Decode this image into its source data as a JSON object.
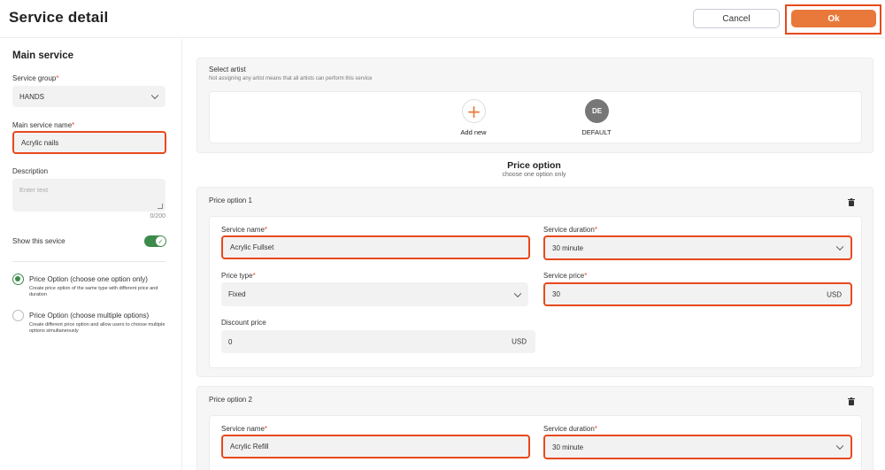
{
  "header": {
    "title": "Service detail",
    "cancel_label": "Cancel",
    "ok_label": "Ok"
  },
  "main_service": {
    "section_title": "Main service",
    "service_group_label": "Service group",
    "service_group_value": "HANDS",
    "main_service_name_label": "Main service name",
    "main_service_name_value": "Acrylic nails",
    "description_label": "Description",
    "description_placeholder": "Enter text",
    "description_counter": "0/200",
    "show_service_label": "Show this sevice",
    "show_service_on": true,
    "options": [
      {
        "title": "Price Option (choose one option only)",
        "desc": "Create price option of the same type with different price and duration",
        "selected": true
      },
      {
        "title": "Price Option (choose multiple options)",
        "desc": "Create different price option and allow users to choose multiple options simultaneously",
        "selected": false
      }
    ]
  },
  "artist": {
    "title": "Select artist",
    "subtitle": "Not assigning any artist means that all artists can perform this service",
    "add_new_label": "Add new",
    "artists": [
      {
        "initials": "DE",
        "name": "DEFAULT"
      }
    ]
  },
  "price_section": {
    "title": "Price option",
    "subtitle": "choose one option only"
  },
  "price_options": [
    {
      "title": "Price option 1",
      "service_name_label": "Service name",
      "service_name_value": "Acrylic Fullset",
      "service_duration_label": "Service duration",
      "service_duration_value": "30 minute",
      "price_type_label": "Price type",
      "price_type_value": "Fixed",
      "service_price_label": "Service price",
      "service_price_value": "30",
      "service_price_currency": "USD",
      "discount_price_label": "Discount price",
      "discount_price_value": "0",
      "discount_price_currency": "USD"
    },
    {
      "title": "Price option 2",
      "service_name_label": "Service name",
      "service_name_value": "Acrylic Refill",
      "service_duration_label": "Service duration",
      "service_duration_value": "30 minute"
    }
  ],
  "colors": {
    "accent_orange": "#e8793b",
    "highlight_red": "#e8491d",
    "toggle_green": "#3c8b4b"
  }
}
